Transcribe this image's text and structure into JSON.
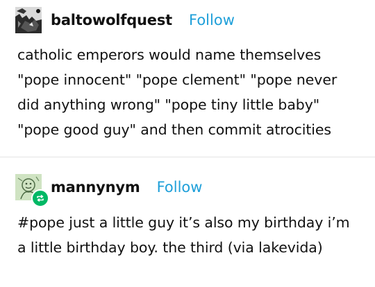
{
  "posts": [
    {
      "username": "baltowolfquest",
      "follow_label": "Follow",
      "body": "catholic emperors would name themselves \"pope innocent\" \"pope clement\" \"pope never did anything wrong\" \"pope tiny little baby\" \"pope good guy\" and then commit atrocities",
      "avatar_icon": "wolf-sketch-avatar"
    },
    {
      "username": "mannynym",
      "follow_label": "Follow",
      "body": "#pope just a little guy it’s also my birthday i’m a little birthday boy. the third (via lakevida)",
      "avatar_icon": "doodle-avatar",
      "badge_icon": "reblog-icon"
    }
  ],
  "colors": {
    "follow": "#1e9fd9",
    "reblog_badge": "#00b865",
    "divider": "#e4e4e4"
  }
}
